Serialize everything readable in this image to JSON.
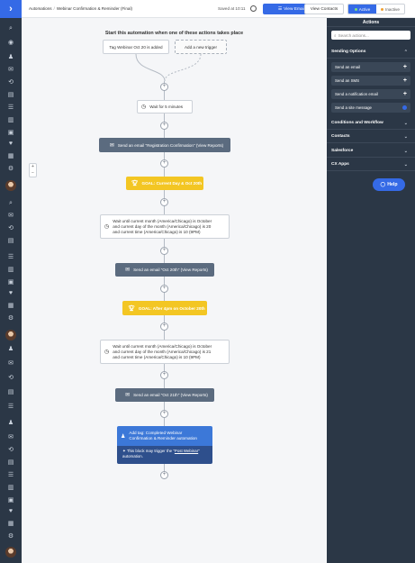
{
  "header": {
    "breadcrumb_root": "Automations",
    "breadcrumb_sep": "/",
    "breadcrumb_current": "Webinar Confirmation & Reminder (Final)",
    "saved_text": "Saved at 10:11",
    "view_emails_label": "View Emails",
    "view_contacts_label": "View Contacts",
    "active_label": "Active",
    "inactive_label": "Inactive"
  },
  "canvas": {
    "start_title": "Start this automation when one of these actions takes place",
    "trigger_1": "Tag Webinar Oct 20 is added",
    "trigger_2": "Add a new trigger",
    "zoom_in": "+",
    "zoom_out": "−",
    "plus": "+",
    "steps": {
      "wait_5": "Wait for 5 minutes",
      "email_1": "Send an email \"Registration Confirmation\" (View Reports)",
      "goal_1": "GOAL: Current Day & Oct 20th",
      "wait_2_line1": "Wait until current month (America/Chicago) is October",
      "wait_2_line2": "and current day of the month (America/Chicago) is 20",
      "wait_2_line3": "and current time (America/Chicago) is 10 (9PM)",
      "email_2": "Send an email \"Oct 20th\" (View Reports)",
      "goal_2": "GOAL: After 4pm on October 20th",
      "wait_3_line1": "Wait until current month (America/Chicago) is October",
      "wait_3_line2": "and current day of the month (America/Chicago) is 21",
      "wait_3_line3": "and current time (America/Chicago) is 10 (9PM)",
      "email_3": "Send an email \"Oct 21th\" (View Reports)",
      "tag_line1": "Add tag: Completed Webinar",
      "tag_line2": "Confirmation & Reminder automation",
      "tag_note_pre": "This block may trigger the",
      "tag_note_link": "Post Webinar",
      "tag_note_post": "automation."
    }
  },
  "panel": {
    "title": "Actions",
    "search_placeholder": "Search actions...",
    "sending_options": "Sending Options",
    "items": [
      "Send an email",
      "Send an SMS",
      "Send a notification email",
      "Send a site message"
    ],
    "sections": [
      "Conditions and Workflow",
      "Contacts",
      "Salesforce",
      "CX Apps"
    ],
    "help_label": "Help"
  },
  "colors": {
    "brand_blue": "#356ae6",
    "rail_dark": "#2b3746",
    "goal_yellow": "#f3c623",
    "email_gray": "#5b6b7f"
  }
}
